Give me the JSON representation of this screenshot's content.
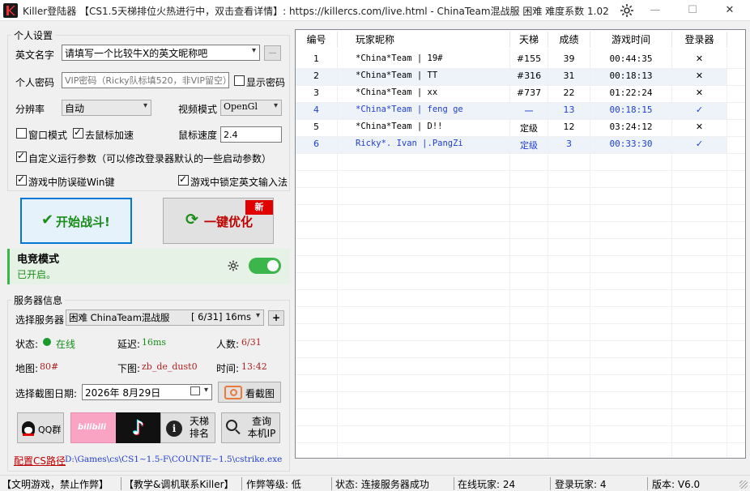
{
  "window": {
    "title": "Killer登陆器 【CS1.5天梯排位火热进行中，双击查看详情】: https://killercs.com/live.html - ChinaTeam混战服 困难 难度系数 1.02",
    "settings_icon": "gear-icon",
    "min_glyph": "—",
    "max_glyph": "☐",
    "close_glyph": "✕"
  },
  "personal": {
    "group_title": "个人设置",
    "name_label": "英文名字",
    "name_placeholder": "请填写一个比较牛X的英文昵称吧",
    "name_btn": "—",
    "password_label": "个人密码",
    "password_placeholder": "VIP密码（Ricky队标填520，非VIP留空）",
    "show_password_label": "显示密码",
    "resolution_label": "分辨率",
    "resolution_value": "自动",
    "video_label": "视频模式",
    "video_value": "OpenGl",
    "window_mode_label": "窗口模式",
    "mouse_accel_label": "去鼠标加速",
    "mouse_speed_label": "鼠标速度",
    "mouse_speed_value": "2.4",
    "custom_params_label": "自定义运行参数（可以修改登录器默认的一些启动参数）",
    "anti_win_label": "游戏中防误碰Win键",
    "lock_ime_label": "游戏中锁定英文输入法"
  },
  "actions": {
    "start_label": "开始战斗!",
    "optimize_label": "一键优化",
    "new_badge": "新"
  },
  "esports": {
    "title": "电竞模式",
    "status": "已开启。",
    "enabled": true
  },
  "server": {
    "group_title": "服务器信息",
    "select_label": "选择服务器",
    "selected": "困难 ChinaTeam混战服",
    "selected_info": "[ 6/31] 16ms",
    "add_btn": "+",
    "status_label": "状态:",
    "status_value": "在线",
    "latency_label": "延迟:",
    "latency_value": "16ms",
    "players_label": "人数:",
    "players_value": "6/31",
    "map_label": "地图:",
    "map_value": "80#",
    "next_map_label": "下图:",
    "next_map_value": "zb_de_dust0",
    "time_label": "时间:",
    "time_value": "13:42",
    "date_label": "选择截图日期:",
    "date_value": "2026年  8月29日",
    "screenshot_btn": "看截图"
  },
  "social": {
    "qq_label": "QQ群",
    "bilibili_label": "bilibili",
    "ladder_label": "天梯\n排名",
    "ip_label": "查询\n本机IP"
  },
  "path": {
    "label": "配置CS路径",
    "value": "D:\\Games\\cs\\CS1~1.5-F\\COUNTE~1.5\\cstrike.exe"
  },
  "table": {
    "columns": [
      "编号",
      "玩家昵称",
      "天梯",
      "成绩",
      "游戏时间",
      "登录器"
    ],
    "rows": [
      {
        "id": "1",
        "name": "*China*Team | 19#",
        "ladder": "#155",
        "score": "39",
        "time": "00:44:35",
        "launcher": "✕",
        "blue": false
      },
      {
        "id": "2",
        "name": "*China*Team | TT",
        "ladder": "#316",
        "score": "31",
        "time": "00:18:13",
        "launcher": "✕",
        "blue": false
      },
      {
        "id": "3",
        "name": "*China*Team | xx",
        "ladder": "#737",
        "score": "22",
        "time": "01:22:24",
        "launcher": "✕",
        "blue": false
      },
      {
        "id": "4",
        "name": "*China*Team | feng ge",
        "ladder": "一",
        "score": "13",
        "time": "00:18:15",
        "launcher": "✓",
        "blue": true
      },
      {
        "id": "5",
        "name": "*China*Team | D!!",
        "ladder": "定级",
        "score": "12",
        "time": "03:24:12",
        "launcher": "✕",
        "blue": false
      },
      {
        "id": "6",
        "name": "Ricky*. Ivan |.PangZi",
        "ladder": "定级",
        "score": "3",
        "time": "00:33:30",
        "launcher": "✓",
        "blue": true
      }
    ]
  },
  "status_bar": {
    "notice": "【文明游戏，禁止作弊】",
    "contact": "【教学&调机联系Killer】",
    "cheat_level": "作弊等级: 低",
    "state": "状态: 连接服务器成功",
    "online": "在线玩家: 24",
    "logged": "登录玩家: 4",
    "version": "版本: V6.0"
  },
  "colors": {
    "accent_green": "#1a8d1a",
    "toggle_green": "#3cb54a",
    "badge_red": "#e00000",
    "row_blue": "#1f3fd1"
  }
}
